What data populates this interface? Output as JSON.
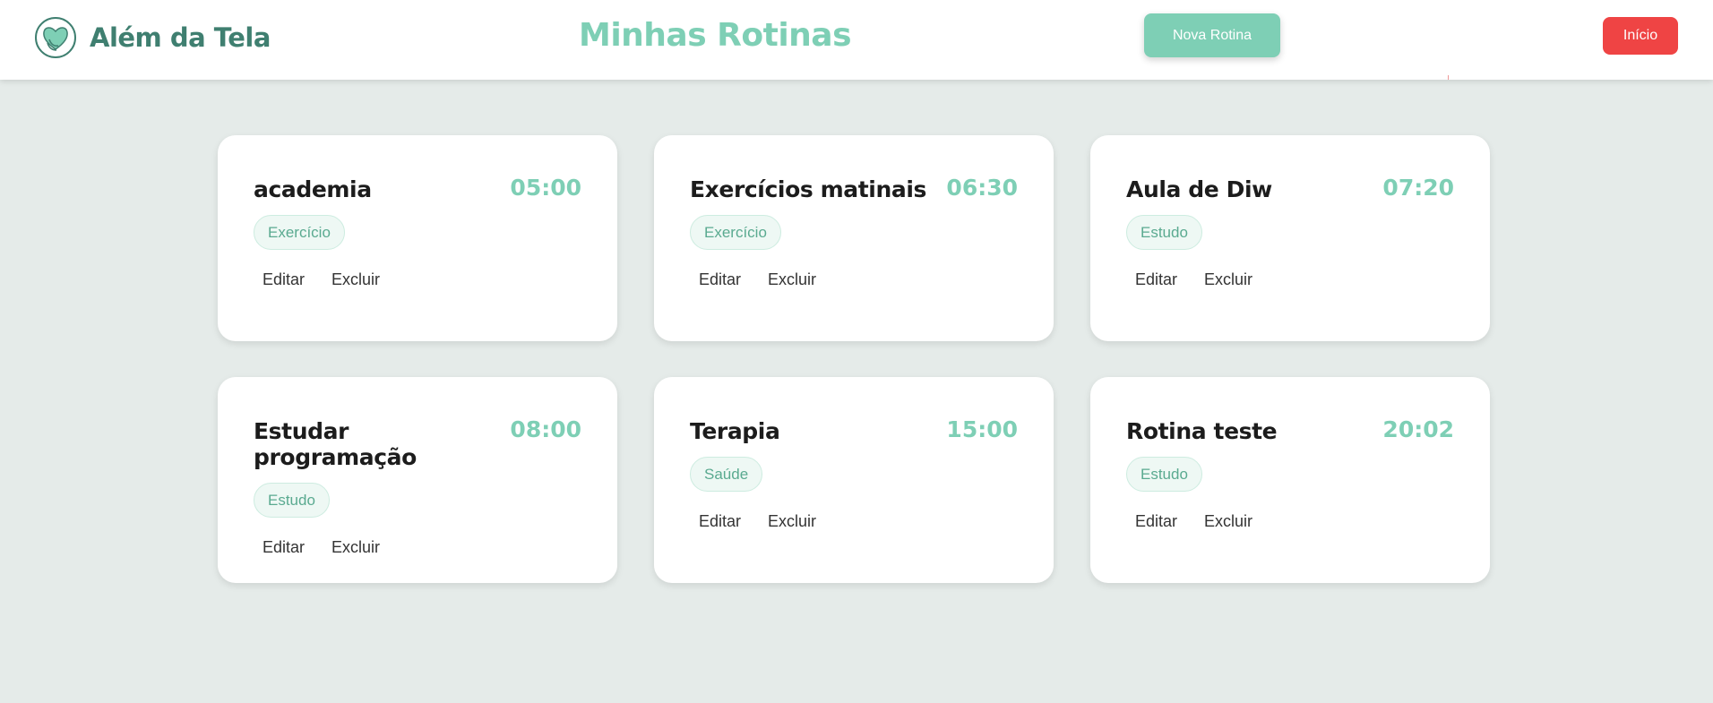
{
  "app": {
    "brand_name": "Além da Tela",
    "page_title": "Minhas Rotinas",
    "new_routine_label": "Nova Rotina",
    "home_label": "Início"
  },
  "colors": {
    "accent": "#7ecfb5",
    "brand": "#3f7f70",
    "danger": "#ef4444",
    "background": "#e5ebe9"
  },
  "icons": {
    "logo": "leaf-heart-logo-icon"
  },
  "routines": [
    {
      "name": "academia",
      "time": "05:00",
      "category": "Exercício",
      "edit_label": "Editar",
      "delete_label": "Excluir"
    },
    {
      "name": "Exercícios matinais",
      "time": "06:30",
      "category": "Exercício",
      "edit_label": "Editar",
      "delete_label": "Excluir"
    },
    {
      "name": "Aula de Diw",
      "time": "07:20",
      "category": "Estudo",
      "edit_label": "Editar",
      "delete_label": "Excluir"
    },
    {
      "name": "Estudar programação",
      "time": "08:00",
      "category": "Estudo",
      "edit_label": "Editar",
      "delete_label": "Excluir"
    },
    {
      "name": "Terapia",
      "time": "15:00",
      "category": "Saúde",
      "edit_label": "Editar",
      "delete_label": "Excluir"
    },
    {
      "name": "Rotina teste",
      "time": "20:02",
      "category": "Estudo",
      "edit_label": "Editar",
      "delete_label": "Excluir"
    }
  ]
}
